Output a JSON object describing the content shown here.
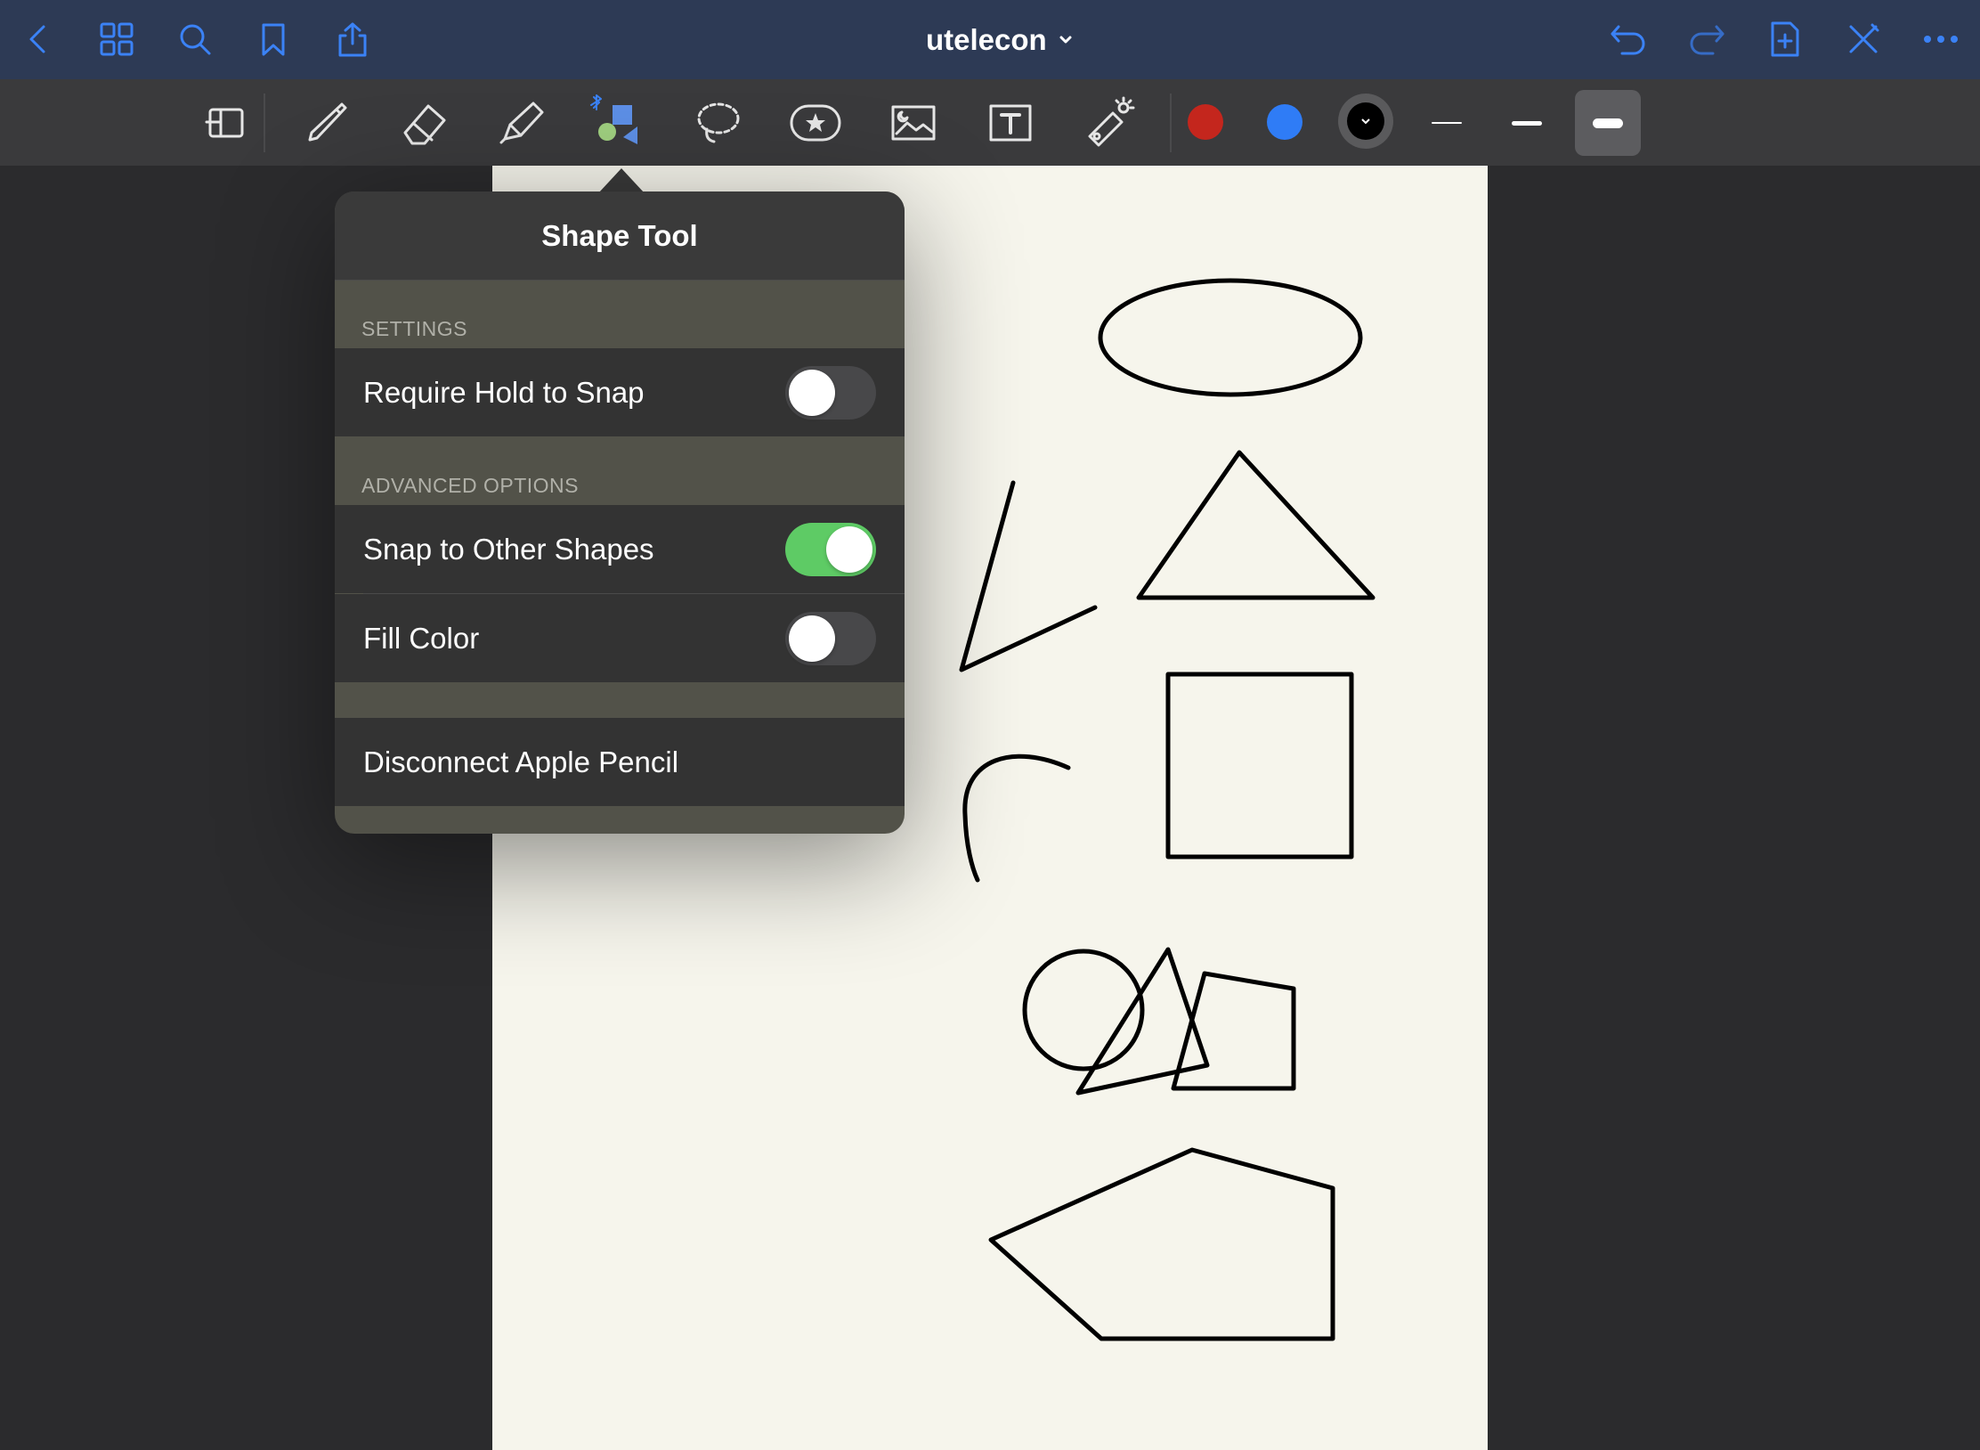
{
  "topbar": {
    "document_title": "utelecon",
    "left_icons": [
      "back-icon",
      "grid-icon",
      "search-icon",
      "bookmark-icon",
      "share-icon"
    ],
    "right_icons": [
      "undo-icon",
      "redo-icon",
      "add-page-icon",
      "close-toolbar-icon",
      "more-icon"
    ],
    "accent": "#3b82f6"
  },
  "toolbar": {
    "tools": [
      "tool-scan",
      "pen",
      "eraser",
      "highlighter",
      "shapes",
      "lasso",
      "elements",
      "image",
      "text",
      "laser-pointer"
    ],
    "active_tool": "shapes",
    "colors": [
      "#c4261d",
      "#2f7cf6",
      "#000000"
    ],
    "selected_color": "#000000",
    "stroke_widths": [
      "thin",
      "medium",
      "thick"
    ],
    "selected_stroke": "thick"
  },
  "popover": {
    "title": "Shape Tool",
    "settings_header": "SETTINGS",
    "require_hold": {
      "label": "Require Hold to Snap",
      "on": false
    },
    "advanced_header": "ADVANCED OPTIONS",
    "snap_shapes": {
      "label": "Snap to Other Shapes",
      "on": true
    },
    "fill_color": {
      "label": "Fill Color",
      "on": false
    },
    "disconnect_label": "Disconnect Apple Pencil"
  },
  "canvas": {
    "background": "#f6f5ec",
    "shapes": [
      "ellipse",
      "triangle",
      "angle-stroke",
      "square",
      "curve-stroke",
      "circle",
      "overlapping-triangle",
      "quadrilateral",
      "pentagon"
    ]
  }
}
